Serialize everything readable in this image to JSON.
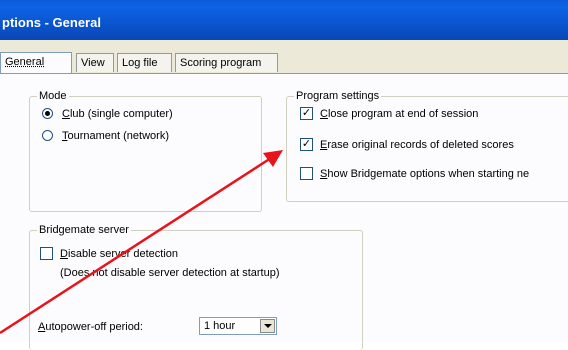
{
  "window": {
    "title": "ptions - General"
  },
  "tabs": [
    {
      "label": "General",
      "active": true
    },
    {
      "label": "View",
      "active": false
    },
    {
      "label": "Log file",
      "active": false
    },
    {
      "label": "Scoring program",
      "active": false
    }
  ],
  "mode": {
    "legend": "Mode",
    "options": [
      {
        "accel": "C",
        "rest": "lub (single computer)",
        "selected": true
      },
      {
        "accel": "T",
        "rest": "ournament (network)",
        "selected": false
      }
    ]
  },
  "program_settings": {
    "legend": "Program settings",
    "items": [
      {
        "accel": "C",
        "rest": "lose program at end of session",
        "checked": true
      },
      {
        "accel": "E",
        "rest": "rase original records of deleted scores",
        "checked": true
      },
      {
        "accel": "S",
        "rest": "how Bridgemate options when starting ne",
        "checked": false
      }
    ]
  },
  "bridgemate_server": {
    "legend": "Bridgemate server",
    "disable_detection": {
      "accel": "D",
      "rest": "isable server detection",
      "checked": false
    },
    "note": "(Does not disable server detection at startup)",
    "autopower": {
      "accel": "A",
      "rest": "utopower-off period:",
      "value": "1 hour"
    }
  },
  "annotation": {
    "color": "#e8141b"
  },
  "colors": {
    "titlebar": "#0b56d1",
    "dialog": "#ece9d8"
  }
}
